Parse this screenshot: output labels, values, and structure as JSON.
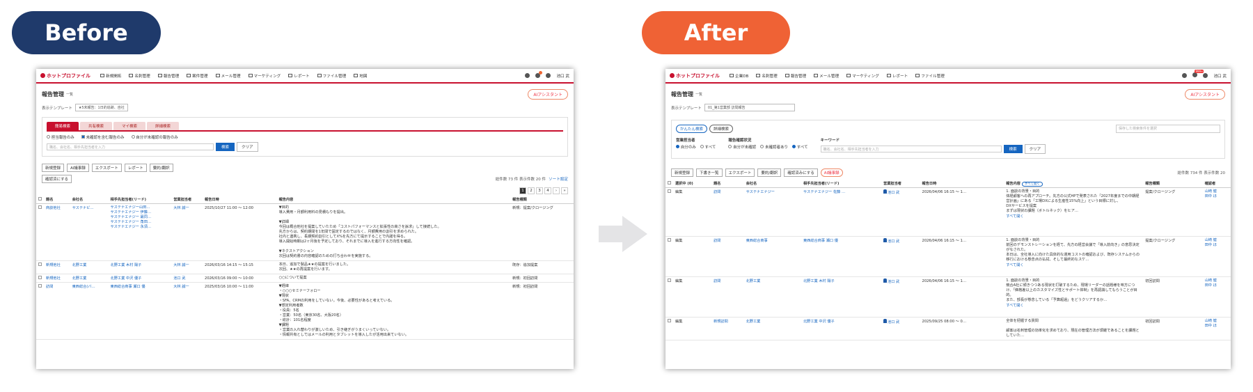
{
  "before_label": "Before",
  "after_label": "After",
  "before": {
    "logo": "ホットプロファイル",
    "nav": [
      "新規開拓",
      "名刺管理",
      "報告管理",
      "案件管理",
      "メール管理",
      "マーケティング",
      "レポート",
      "ファイル管理",
      "地図"
    ],
    "user": "池口 武",
    "page_title": "報告管理",
    "page_sub": "一覧",
    "ai_button": "AIアシスタント",
    "template_label": "表示テンプレート",
    "template_value": "★5未報告：1日的追跡、自社",
    "tabs": [
      "簡易検索",
      "共有検索",
      "マイ検索",
      "詳細検索"
    ],
    "radios": [
      "担当報告のみ",
      "未確認を含む報告のみ",
      "自分が未確認の報告のみ"
    ],
    "search_placeholder": "職名、会社名、相手先担当者を入力",
    "search_btn": "検索",
    "clear_btn": "クリア",
    "toolbar": [
      "新規登録",
      "AI議事録",
      "エクスポート",
      "レポート",
      "要約/翻訳"
    ],
    "confirm_btn": "確認済にする",
    "count_text": "総件数 73 件 表示件数 20 件",
    "sort_setting": "ソート設定",
    "pages": [
      "1",
      "2",
      "3",
      "4",
      "›",
      "»"
    ],
    "columns": [
      "題名",
      "会社名",
      "相手先担当者(リード)",
      "営業担当者",
      "報告日時",
      "報告内容",
      "報告種類"
    ],
    "rows": [
      {
        "title": "商談他社",
        "company": "サステナビ…",
        "contact": "サステナエナジー山田…\nサステナエナジー 伊藤…\nサステナエナジー 最同…\nサステナエナジー 角田…\nサステナエナジー 永須…",
        "owner": "大林 誠一",
        "date": "2025/10/27 11:00 ～ 12:00",
        "detail": "▼目的\n導入費用・月額利用料の見積もりを提出。\n\n▼詳細\n今回は概合他社を提案していたため「コストパフォーマンスと拡張性の高さを訴求」して接続した。\n先方からは、契約期間を1年間で固定するのではなく、月額費用の割引を求められた。\n社内と連携し、長期契約割引としてX%を先方にて提示することで内諾を得る。\n導入開始時期は2ヶ月後を予定しており、それまでに導入を進行する方向性を確認。\n\n▼ネクストアクション\n次回は契約書の内容確認のための打ち合わせを実施する。",
        "kind": "新規：提案/クロージング"
      },
      {
        "title": "新規他社",
        "company": "北野工業",
        "contact": "北野工業 木村 陽子",
        "owner": "大林 誠一",
        "date": "2026/03/16 14:15 ～ 15:15",
        "detail": "本日、追加で製品★★の提案を行いました。\n次回、★★の再提案を行います。",
        "kind": "既存：追加提案"
      },
      {
        "title": "新規他社",
        "company": "北野工業",
        "contact": "北野工業 中沢 優子",
        "owner": "池口 武",
        "date": "2026/03/16 09:00 ～ 10:00",
        "detail": "○○について提案",
        "kind": "新規：初回訪問"
      },
      {
        "title": "訪問",
        "company": "東西総合(バ…",
        "contact": "東西総合商事 瀬口 優",
        "owner": "大林 誠一",
        "date": "2025/03/16 10:00 ～ 11:00",
        "detail": "▼経緯\n・○○○セミナーフォロー\n▼現状\n・SFA、CRMの利用をしていない。今後、必要性があると考えている。\n▼想定利用者数\n・役員：5名\n・営業：50名（東京30名、大阪20名）\n・総計：101名程度\n▼課題\n・営業の入れ替わりが激しいため、引き継ぎがうまくいっていない。\n・情報共有としてはメールの利用とタブレットを導入したが活用出来ていない。",
        "kind": "新規：初回訪問"
      }
    ]
  },
  "after": {
    "logo": "ホットプロファイル",
    "nav": [
      "企業DB",
      "名刺管理",
      "報告管理",
      "メール管理",
      "マーケティング",
      "レポート",
      "ファイル管理"
    ],
    "nav_badge": "999+",
    "user": "池口 武",
    "page_title": "報告管理",
    "page_sub": "一覧",
    "ai_button": "AIアシスタント",
    "template_label": "表示テンプレート",
    "template_value": "01_第1営業部 訪問報告",
    "quick_tabs": [
      "かんたん検索",
      "詳細検索"
    ],
    "saved_search_placeholder": "保存した検索条件を選択",
    "owner_label": "営業担当者",
    "owner_opts": [
      "自分のみ",
      "すべて"
    ],
    "status_label": "報告確認状況",
    "status_opts": [
      "自分が未確認",
      "未確認者あり",
      "すべて"
    ],
    "keyword_label": "キーワード",
    "keyword_placeholder": "職名、会社名、相手先担当者を入力",
    "search_btn": "検索",
    "clear_btn": "クリア",
    "toolbar": [
      "新規登録",
      "下書き一覧",
      "エクスポート",
      "要約/翻訳",
      "確認済みにする",
      "AI議事録"
    ],
    "count_text": "総件数 734 件  表示件数 20",
    "columns": [
      "選択中 (0)",
      "題名",
      "会社名",
      "相手先担当者(リード)",
      "営業担当者",
      "報告日時",
      "報告内容",
      "報告種類",
      "確認者"
    ],
    "expand_all": "すべて開く",
    "edit_label": "編集",
    "more_label": "すべて開く",
    "rows": [
      {
        "title": "訪問",
        "company": "サステナエナジー",
        "contact": "サステナエナジー 佐藤 …",
        "owner": "池口 武",
        "date": "2026/04/06 16:15 ～ 1…",
        "detail": "1. 面談の背景・目的\n体経顧客への再アプローチ。先方の公式HPで発表された「2027年度までの中期経営計画」にある「工場DXによる生産性15%向上」という目標に対し、\nDXサービスを提案\nまずは現状の課題（ボトルネック）をヒア…",
        "kind": "提案/クロージング",
        "confirm": "山崎 健\n田中 ほ"
      },
      {
        "title": "訪問",
        "company": "東西総合商事",
        "contact": "東西総合商事 瀬口 優",
        "owner": "池口 武",
        "date": "2026/04/06 16:15 ～ 1…",
        "detail": "1. 面談の背景・目的\n前回のデモンストレーションを経て、先方の経営会議で「導入前向き」の意思決定がなされた。\n本日は、全社導入に向けた具体的な運用コストの確認および、既存システムからの移行における懸念点の払拭、そして最終的なスケ…",
        "kind": "提案/クロージング",
        "confirm": "山崎 健\n田中 ほ"
      },
      {
        "title": "訪問",
        "company": "北野工業",
        "contact": "北野工業 木村 陽子",
        "owner": "池口 武",
        "date": "2026/04/06 16:15 ～ 1…",
        "detail": "1. 面談の背景・目的\n競合A社に傾きつつある現状を打破するため、現場リーダーの話題様を味方につけ、「価格差以上のカスタマイズ性とサポート体制」を再認識してもらうことが目的。\nまた、部長が懸念している「予算超過」をどうクリアするか…",
        "kind": "初回訪問",
        "confirm": "山崎 健\n田中 ほ"
      },
      {
        "title": "新規訪問",
        "company": "北野工業",
        "contact": "北野工業 中沢 優子",
        "owner": "池口 武",
        "date": "2025/09/25 08:00 ～ 0…",
        "detail": "全体を把握する質問\n\n顧客は名刺管理の効率化を求めており、現在の管理方法が煩雑であることを課題としていた…",
        "kind": "初回訪問",
        "confirm": "山崎 健\n田中 ほ"
      }
    ]
  }
}
